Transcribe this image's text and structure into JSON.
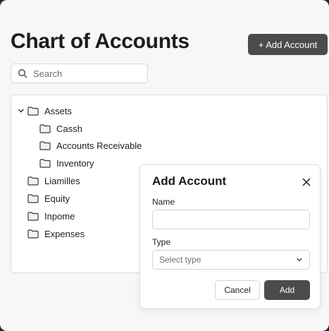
{
  "header": {
    "title": "Chart of Accounts",
    "add_button_label": "+ Add Account"
  },
  "search": {
    "placeholder": "Search",
    "icon": "search-icon"
  },
  "tree": {
    "folder_icon": "folder-icon",
    "items": [
      {
        "label": "Assets",
        "expanded": true,
        "level": 0
      },
      {
        "label": "Cassh",
        "level": 1
      },
      {
        "label": "Accounts Receivable",
        "level": 1
      },
      {
        "label": "Inventory",
        "level": 1
      },
      {
        "label": "Liamilles",
        "level": 0
      },
      {
        "label": "Equity",
        "level": 0
      },
      {
        "label": "Inpome",
        "level": 0
      },
      {
        "label": "Expenses",
        "level": 0
      }
    ]
  },
  "modal": {
    "title": "Add Account",
    "close_icon": "close-icon",
    "name_label": "Name",
    "name_value": "",
    "type_label": "Type",
    "type_placeholder": "Select type",
    "cancel_label": "Cancel",
    "add_label": "Add"
  },
  "colors": {
    "primary_button": "#4b4b4b",
    "background": "#f7f7f7",
    "panel": "#ffffff"
  }
}
